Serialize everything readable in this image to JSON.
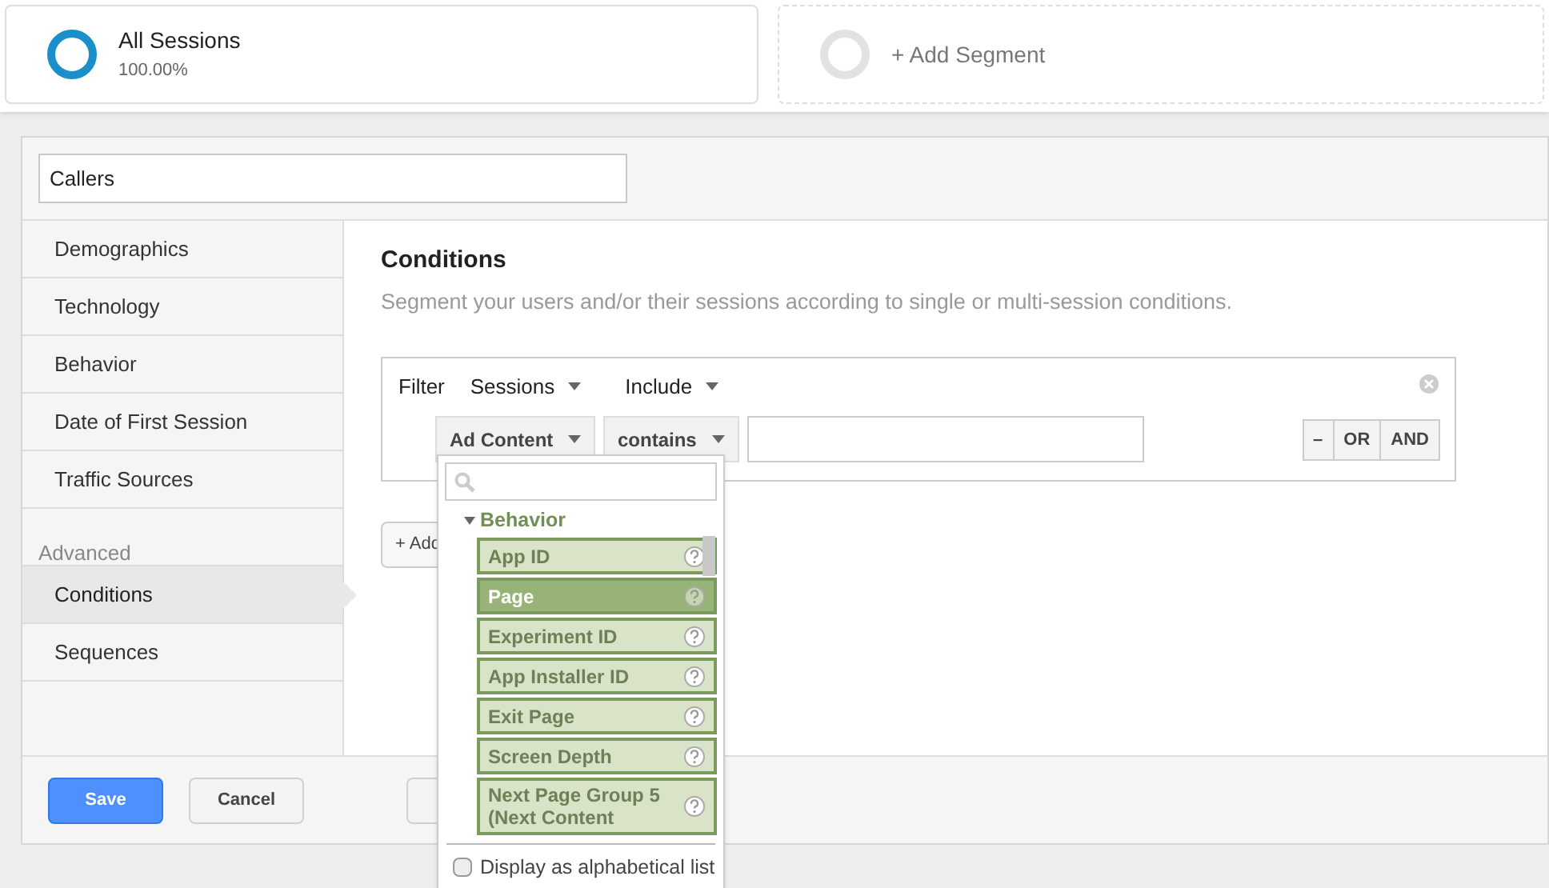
{
  "segments": [
    {
      "kind": "active",
      "name": "All Sessions",
      "share": "100.00%"
    },
    {
      "kind": "add",
      "name": "+ Add Segment"
    }
  ],
  "segment_name": {
    "value": "Callers"
  },
  "sidebar": {
    "items": [
      {
        "label": "Demographics",
        "selected": false
      },
      {
        "label": "Technology",
        "selected": false
      },
      {
        "label": "Behavior",
        "selected": false
      },
      {
        "label": "Date of First Session",
        "selected": false
      },
      {
        "label": "Traffic Sources",
        "selected": false
      }
    ],
    "section": "Advanced",
    "advanced_items": [
      {
        "label": "Conditions",
        "selected": true
      },
      {
        "label": "Sequences",
        "selected": false
      }
    ]
  },
  "conditions": {
    "title": "Conditions",
    "description": "Segment your users and/or their sessions according to single or multi-session conditions.",
    "filter": {
      "label": "Filter",
      "scope": "Sessions",
      "mode": "Include",
      "dimension": "Ad Content",
      "operator": "contains",
      "logic_buttons": [
        "–",
        "OR",
        "AND"
      ]
    },
    "add_button": "+ Add"
  },
  "dropdown": {
    "group": "Behavior",
    "expanded": true,
    "items": [
      {
        "label": "App ID",
        "selected": false
      },
      {
        "label": "Page",
        "selected": true
      },
      {
        "label": "Experiment ID",
        "selected": false
      },
      {
        "label": "App Installer ID",
        "selected": false
      },
      {
        "label": "Exit Page",
        "selected": false
      },
      {
        "label": "Screen Depth",
        "selected": false
      },
      {
        "label": "Next Page Group 5 (Next Content",
        "selected": false
      }
    ],
    "alphabetical": {
      "label": "Display as alphabetical list",
      "checked": false
    }
  },
  "footer": {
    "buttons": [
      "Save",
      "Cancel"
    ]
  }
}
